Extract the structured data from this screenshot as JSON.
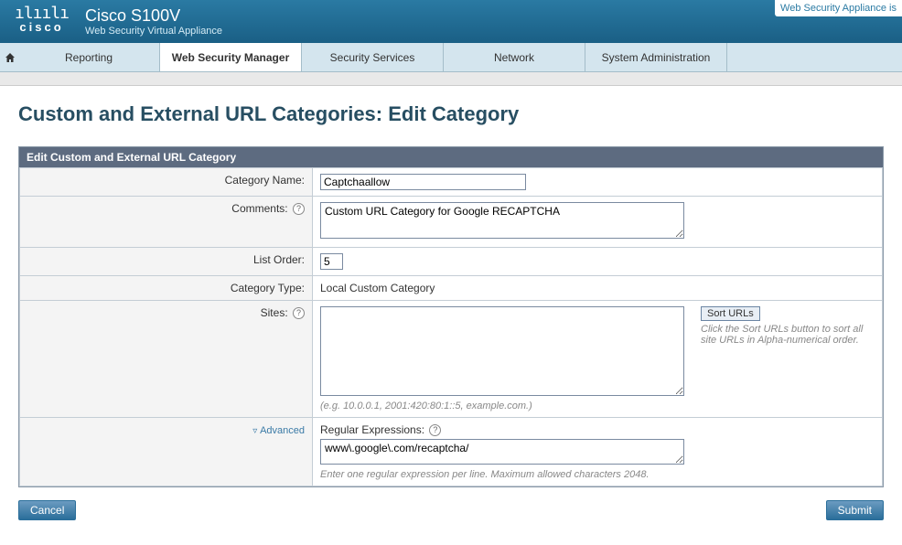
{
  "brand": {
    "logo_text": "cisco",
    "product_main": "Cisco S100V",
    "product_sub": "Web Security Virtual Appliance",
    "top_right": "Web Security Appliance is"
  },
  "nav": {
    "items": [
      {
        "label": "Reporting",
        "active": false
      },
      {
        "label": "Web Security Manager",
        "active": true
      },
      {
        "label": "Security Services",
        "active": false
      },
      {
        "label": "Network",
        "active": false
      },
      {
        "label": "System Administration",
        "active": false
      }
    ]
  },
  "page": {
    "title": "Custom and External URL Categories: Edit Category",
    "panel_title": "Edit Custom and External URL Category"
  },
  "form": {
    "category_name_label": "Category Name:",
    "category_name_value": "Captchaallow",
    "comments_label": "Comments:",
    "comments_value": "Custom URL Category for Google RECAPTCHA",
    "list_order_label": "List Order:",
    "list_order_value": "5",
    "category_type_label": "Category Type:",
    "category_type_value": "Local Custom Category",
    "sites_label": "Sites:",
    "sites_value": "",
    "sites_hint": "(e.g. 10.0.0.1, 2001:420:80:1::5, example.com.)",
    "sort_btn": "Sort URLs",
    "sort_help": "Click the Sort URLs button to sort all site URLs in Alpha-numerical order.",
    "advanced_label": "Advanced",
    "regex_label": "Regular Expressions:",
    "regex_value": "www\\.google\\.com/recaptcha/",
    "regex_hint": "Enter one regular expression per line. Maximum allowed characters 2048."
  },
  "buttons": {
    "cancel": "Cancel",
    "submit": "Submit"
  }
}
